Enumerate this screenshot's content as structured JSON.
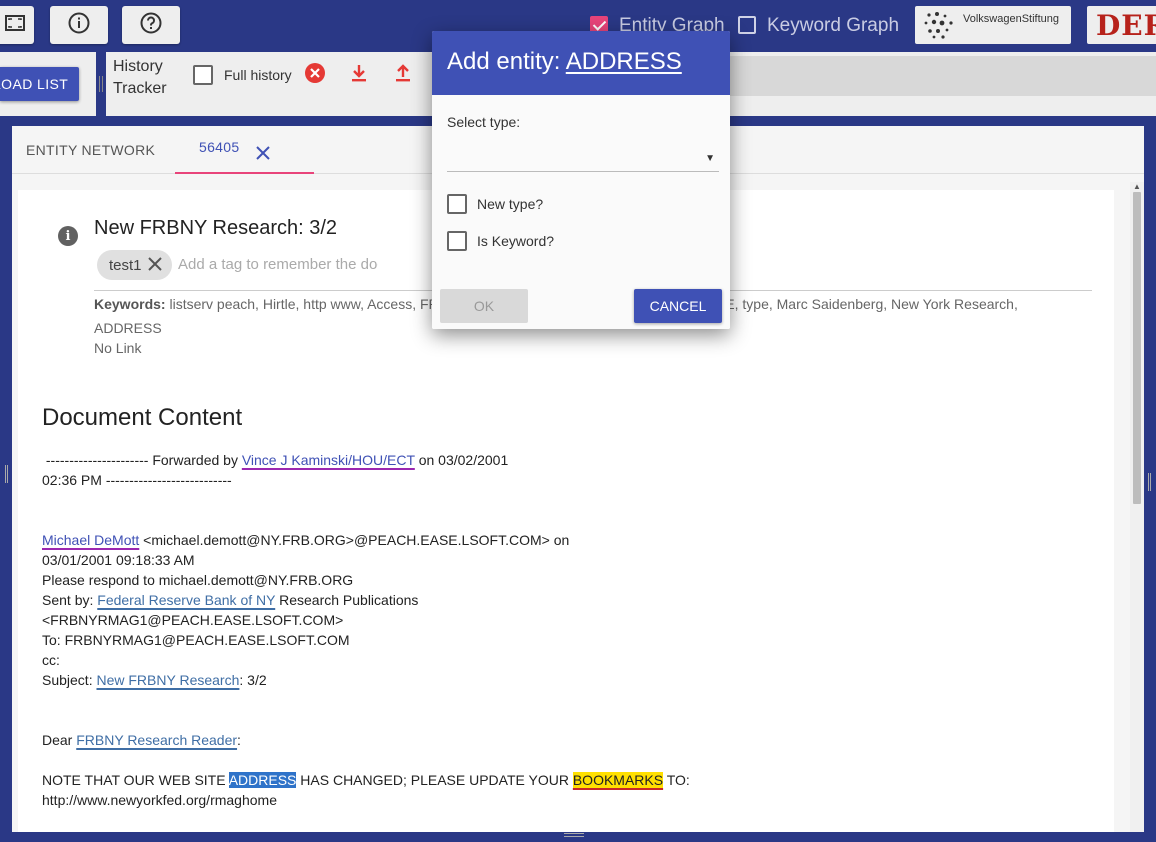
{
  "topbar": {
    "buttons": [
      {
        "icon": "fullscreen-icon"
      },
      {
        "icon": "info-icon"
      },
      {
        "icon": "help-icon"
      }
    ],
    "entity_graph_label": "Entity Graph",
    "entity_graph_checked": true,
    "keyword_graph_label": "Keyword Graph",
    "keyword_graph_checked": false,
    "logo_vw_text": "VolkswagenStiftung",
    "logo_der_text": "DER"
  },
  "toolbar": {
    "load_list_label": "LOAD LIST",
    "history_title_line1": "History",
    "history_title_line2": "Tracker",
    "full_history_label": "Full history",
    "full_history_checked": false,
    "icons": [
      "clear-history-icon",
      "download-icon",
      "upload-icon"
    ]
  },
  "tabs": [
    {
      "label": "ENTITY NETWORK",
      "active": false
    },
    {
      "label": "56405",
      "active": true
    }
  ],
  "document": {
    "title": "New FRBNY Research: 3/2",
    "tags": [
      "test1"
    ],
    "tag_placeholder": "Add a tag to remember the document",
    "keywords_label": "Keywords:",
    "keywords_text": " listserv peach, Hirtle, http www, Access, FRBNY, Research Publications, PLEASE UPDATE, type, Marc Saidenberg, New York Research, ADDRESS",
    "link_text": "No Link",
    "content_heading": "Document Content",
    "lines": {
      "l1a": " ---------------------- Forwarded by ",
      "l1_ent": "Vince J Kaminski/HOU/ECT",
      "l1b": " on 03/02/2001",
      "l2": "02:36 PM ---------------------------",
      "l3_ent": "Michael DeMott",
      "l3b": " <michael.demott@NY.FRB.ORG>@PEACH.EASE.LSOFT.COM> on",
      "l4": "03/01/2001 09:18:33 AM",
      "l5": "Please respond to michael.demott@NY.FRB.ORG",
      "l6a": "Sent by: ",
      "l6_ent": "Federal Reserve Bank of NY",
      "l6b": " Research Publications",
      "l7": "<FRBNYRMAG1@PEACH.EASE.LSOFT.COM>",
      "l8": "To: FRBNYRMAG1@PEACH.EASE.LSOFT.COM",
      "l9": "cc:",
      "l10a": "Subject: ",
      "l10_ent": "New FRBNY Research",
      "l10b": ": 3/2",
      "l11a": "Dear ",
      "l11_ent": "FRBNY Research Reader",
      "l11b": ":",
      "l12a": "NOTE THAT OUR WEB SITE ",
      "l12_sel": "ADDRESS",
      "l12b": " HAS CHANGED; PLEASE UPDATE YOUR ",
      "l12_kw": "BOOKMARKS",
      "l12c": " TO:",
      "l13": "http://www.newyorkfed.org/rmaghome"
    }
  },
  "modal": {
    "title_prefix": "Add entity: ",
    "title_entity": "ADDRESS",
    "select_label": "Select type:",
    "select_value": "",
    "new_type_label": "New type?",
    "new_type_checked": false,
    "is_keyword_label": "Is Keyword?",
    "is_keyword_checked": false,
    "ok_label": "OK",
    "cancel_label": "CANCEL"
  }
}
